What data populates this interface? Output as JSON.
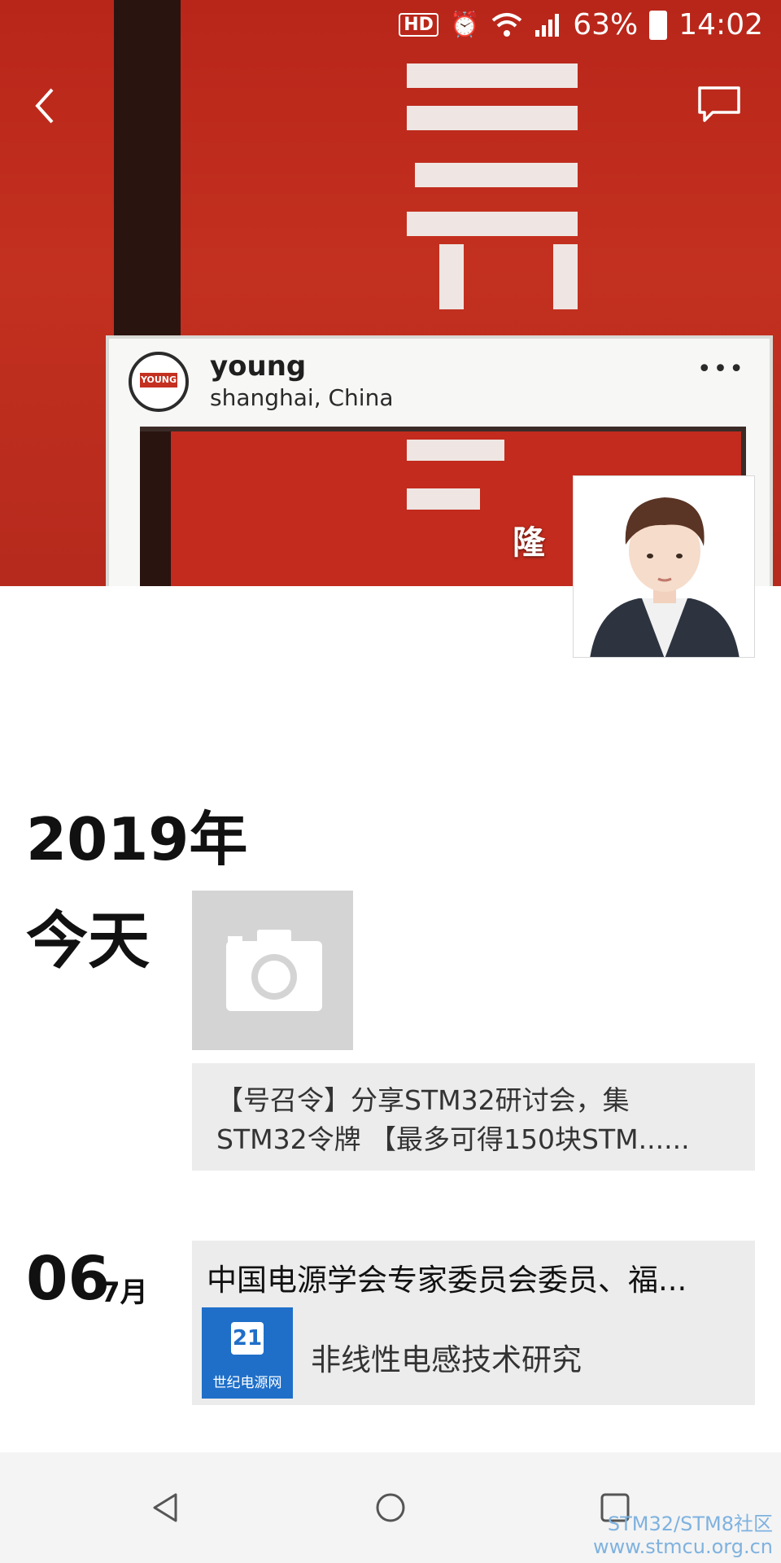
{
  "status_bar": {
    "network": "HD",
    "battery": "63%",
    "time": "14:02"
  },
  "cover": {
    "frame_name": "young",
    "frame_location": "shanghai, China",
    "frame_badge": "YOUNG",
    "frame_menu": "•••"
  },
  "profile": {
    "username": "隆"
  },
  "timeline": {
    "year": "2019年",
    "today_label": "今天",
    "shared_post": {
      "line1": "【号召令】分享STM32研讨会，集",
      "line2": "STM32令牌 【最多可得150块STM......"
    },
    "entry": {
      "day": "06",
      "month": "7月",
      "title": "中国电源学会专家委员会委员、福...",
      "thumb_number": "21",
      "thumb_caption": "世纪电源网",
      "subtitle": "非线性电感技术研究"
    }
  },
  "watermark": {
    "line1": "STM32/STM8社区",
    "line2": "www.stmcu.org.cn"
  }
}
